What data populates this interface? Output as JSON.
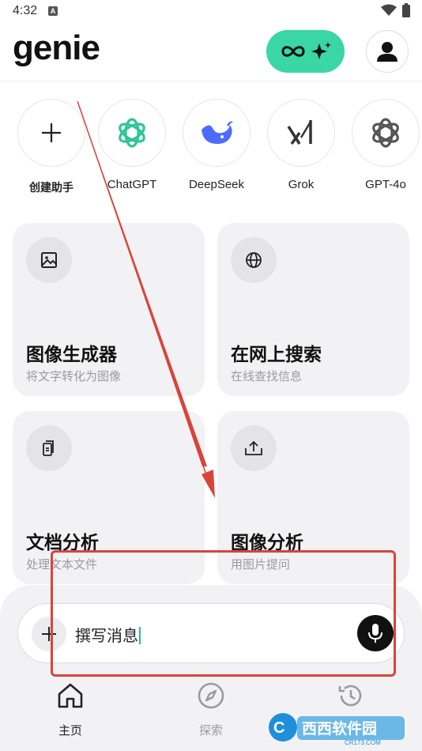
{
  "status_bar": {
    "time": "4:32",
    "notification_glyph": "A"
  },
  "header": {
    "logo": "genie",
    "pro_icon": "infinity-sparkle-icon",
    "avatar_icon": "user-icon"
  },
  "assistants": [
    {
      "label": "创建助手",
      "icon": "plus-icon"
    },
    {
      "label": "ChatGPT",
      "icon": "openai-icon"
    },
    {
      "label": "DeepSeek",
      "icon": "deepseek-whale-icon"
    },
    {
      "label": "Grok",
      "icon": "grok-icon"
    },
    {
      "label": "GPT-4o",
      "icon": "openai-icon"
    }
  ],
  "cards": [
    {
      "title": "图像生成器",
      "subtitle": "将文字转化为图像",
      "icon": "image-icon"
    },
    {
      "title": "在网上搜索",
      "subtitle": "在线查找信息",
      "icon": "globe-icon"
    },
    {
      "title": "文档分析",
      "subtitle": "处理文本文件",
      "icon": "documents-icon"
    },
    {
      "title": "图像分析",
      "subtitle": "用图片提问",
      "icon": "upload-icon"
    }
  ],
  "composer": {
    "value": "撰写消息",
    "plus_icon": "plus-icon",
    "mic_icon": "microphone-icon"
  },
  "bottom_nav": [
    {
      "label": "主页",
      "icon": "home-icon",
      "active": true
    },
    {
      "label": "探索",
      "icon": "compass-icon",
      "active": false
    },
    {
      "label": "",
      "icon": "history-icon",
      "active": false
    }
  ],
  "watermark": {
    "text": "西西软件园",
    "subtext": "CR173.COM"
  },
  "colors": {
    "accent": "#3ad6a4",
    "annotation": "#d9443a",
    "card_bg": "#f2f2f5"
  }
}
